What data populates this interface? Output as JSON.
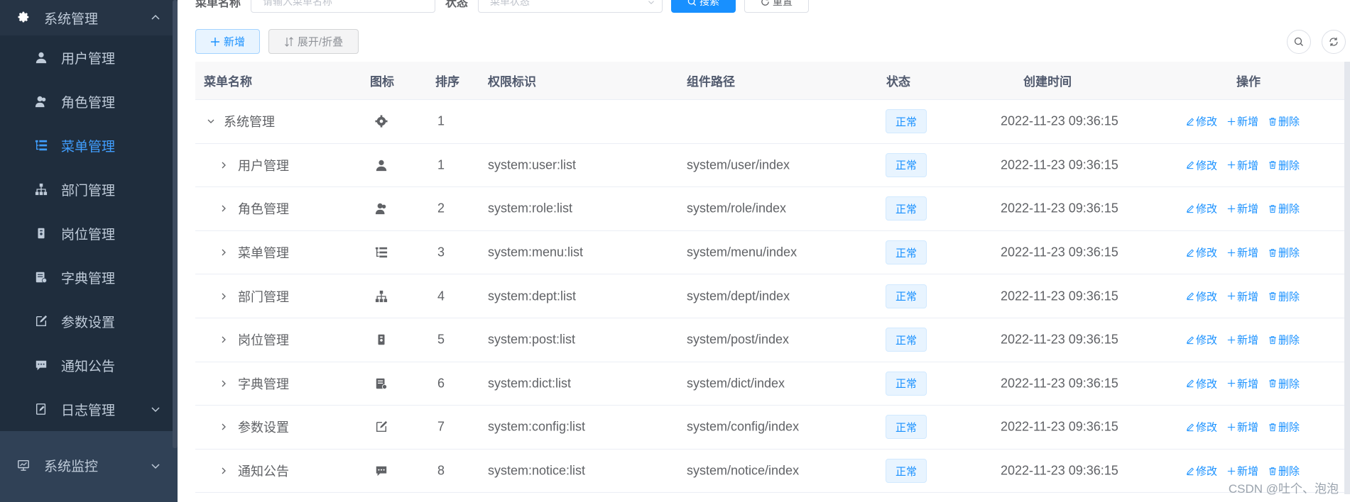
{
  "sidebar": {
    "header_label": "系统管理",
    "items": [
      {
        "label": "用户管理",
        "icon": "user-icon"
      },
      {
        "label": "角色管理",
        "icon": "peoples-icon"
      },
      {
        "label": "菜单管理",
        "icon": "tree-table-icon"
      },
      {
        "label": "部门管理",
        "icon": "tree-icon"
      },
      {
        "label": "岗位管理",
        "icon": "post-icon"
      },
      {
        "label": "字典管理",
        "icon": "dict-icon"
      },
      {
        "label": "参数设置",
        "icon": "edit-icon"
      },
      {
        "label": "通知公告",
        "icon": "message-icon"
      },
      {
        "label": "日志管理",
        "icon": "log-icon"
      }
    ],
    "bottom_label": "系统监控",
    "active_color": "#409eff",
    "bg_color": "#304156"
  },
  "search": {
    "menu_name_label": "菜单名称",
    "menu_name_placeholder": "请输入菜单名称",
    "status_label": "状态",
    "status_placeholder": "菜单状态",
    "search_button": "搜索",
    "reset_button": "重置"
  },
  "toolbar": {
    "add_label": "新增",
    "expand_label": "展开/折叠"
  },
  "table": {
    "headers": {
      "name": "菜单名称",
      "icon": "图标",
      "order": "排序",
      "perms": "权限标识",
      "component": "组件路径",
      "status": "状态",
      "created": "创建时间",
      "actions": "操作"
    },
    "rows": [
      {
        "name": "系统管理",
        "icon": "gear-icon",
        "order": "1",
        "perms": "",
        "component": "",
        "status": "正常",
        "created": "2022-11-23 09:36:15"
      },
      {
        "name": "用户管理",
        "icon": "user-icon",
        "order": "1",
        "perms": "system:user:list",
        "component": "system/user/index",
        "status": "正常",
        "created": "2022-11-23 09:36:15"
      },
      {
        "name": "角色管理",
        "icon": "peoples-icon",
        "order": "2",
        "perms": "system:role:list",
        "component": "system/role/index",
        "status": "正常",
        "created": "2022-11-23 09:36:15"
      },
      {
        "name": "菜单管理",
        "icon": "tree-table-icon",
        "order": "3",
        "perms": "system:menu:list",
        "component": "system/menu/index",
        "status": "正常",
        "created": "2022-11-23 09:36:15"
      },
      {
        "name": "部门管理",
        "icon": "tree-icon",
        "order": "4",
        "perms": "system:dept:list",
        "component": "system/dept/index",
        "status": "正常",
        "created": "2022-11-23 09:36:15"
      },
      {
        "name": "岗位管理",
        "icon": "post-icon",
        "order": "5",
        "perms": "system:post:list",
        "component": "system/post/index",
        "status": "正常",
        "created": "2022-11-23 09:36:15"
      },
      {
        "name": "字典管理",
        "icon": "dict-icon",
        "order": "6",
        "perms": "system:dict:list",
        "component": "system/dict/index",
        "status": "正常",
        "created": "2022-11-23 09:36:15"
      },
      {
        "name": "参数设置",
        "icon": "edit-icon",
        "order": "7",
        "perms": "system:config:list",
        "component": "system/config/index",
        "status": "正常",
        "created": "2022-11-23 09:36:15"
      },
      {
        "name": "通知公告",
        "icon": "message-icon",
        "order": "8",
        "perms": "system:notice:list",
        "component": "system/notice/index",
        "status": "正常",
        "created": "2022-11-23 09:36:15"
      }
    ],
    "action_labels": {
      "edit": "修改",
      "add": "新增",
      "delete": "删除"
    }
  },
  "watermark": "CSDN @吐个、泡泡"
}
